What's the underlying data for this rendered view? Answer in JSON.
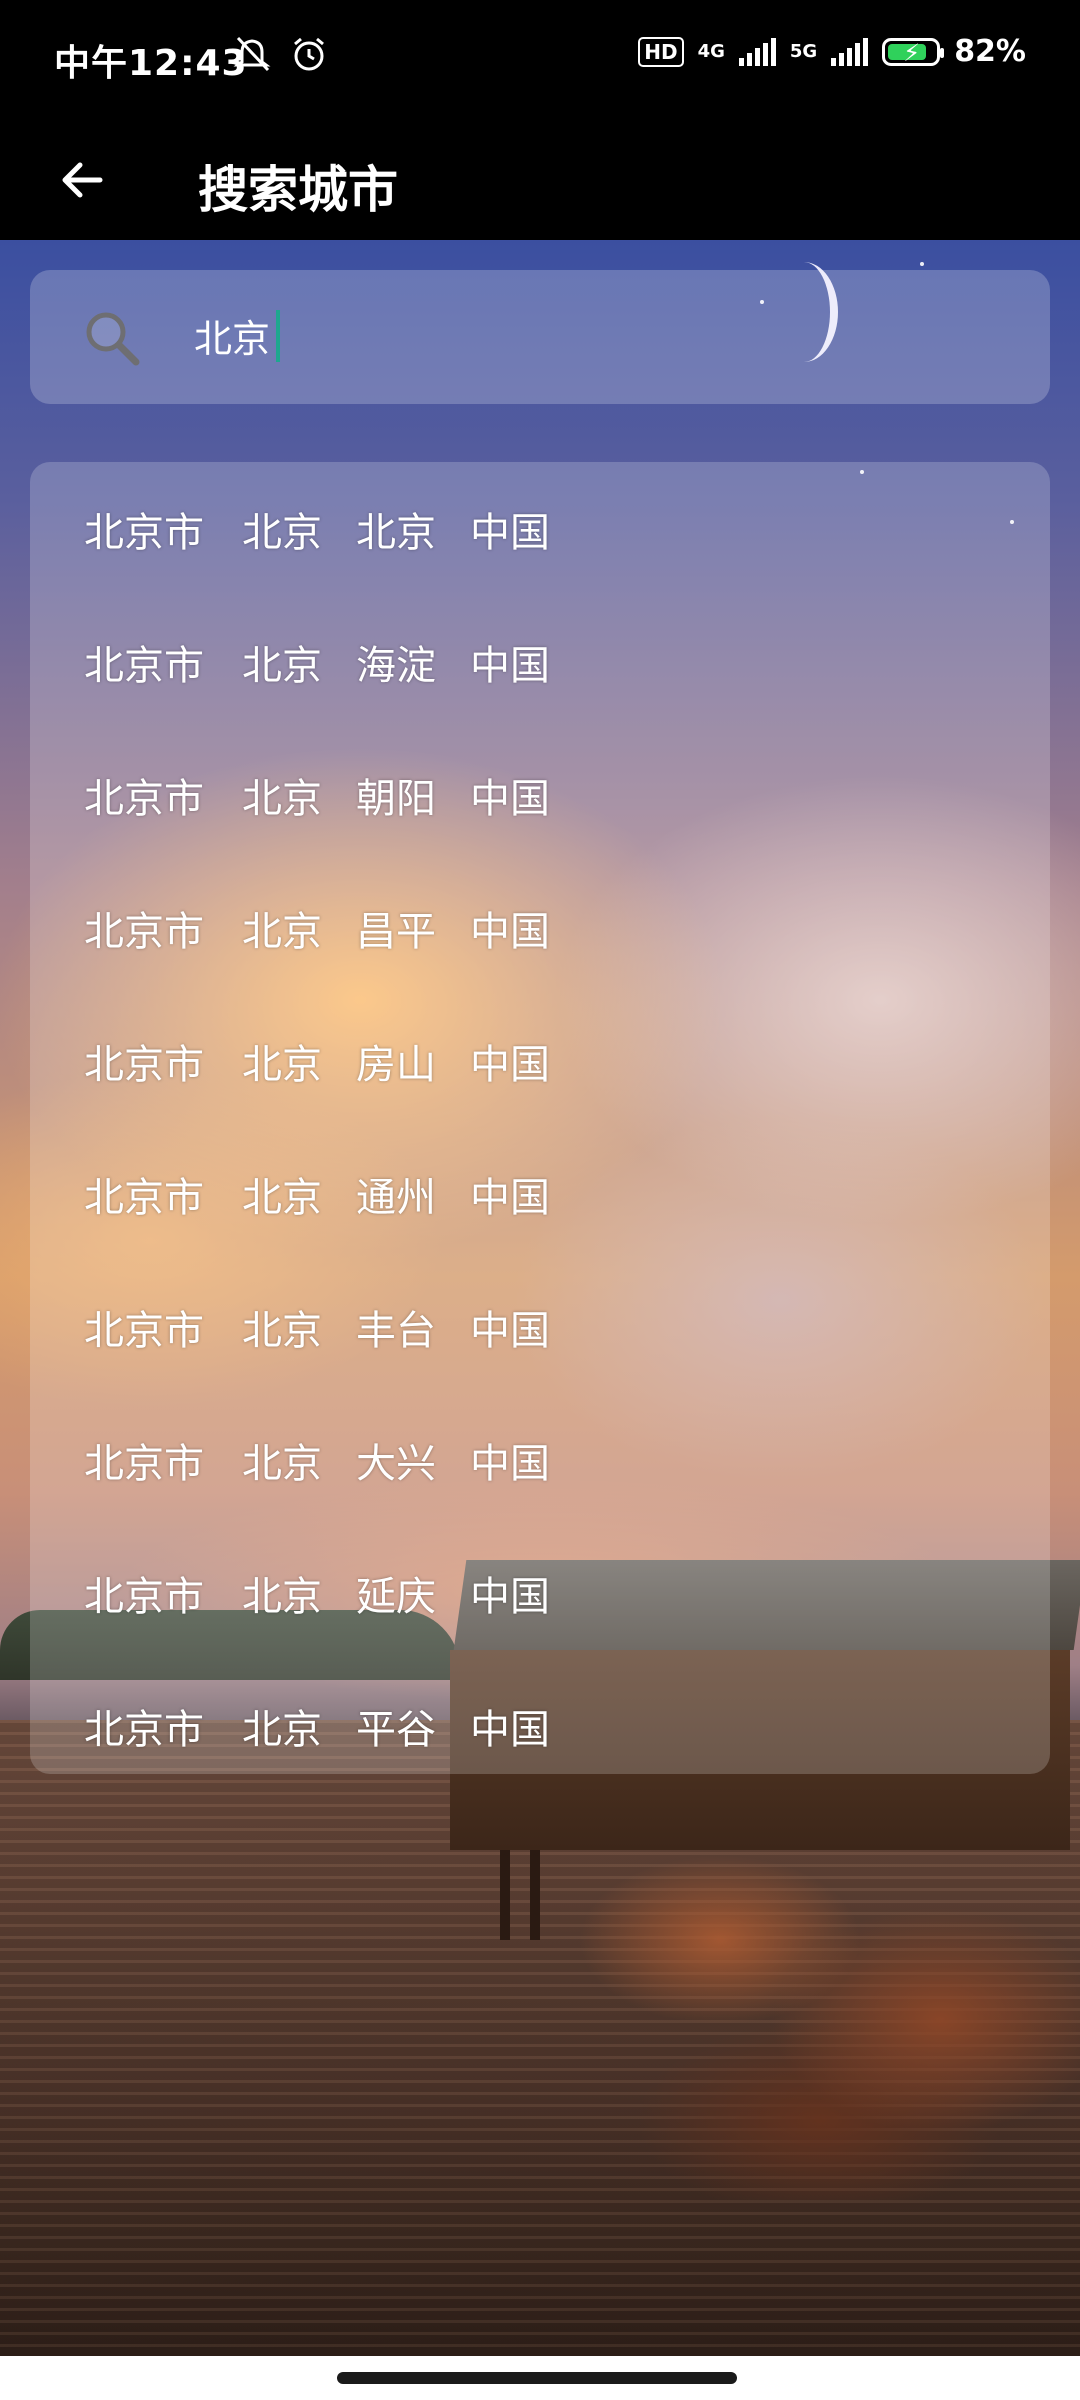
{
  "status_bar": {
    "time": "中午12:43",
    "left_icons": [
      "muted-icon",
      "alarm-icon"
    ],
    "hd": "HD",
    "net1": "4G",
    "net2": "5G",
    "battery": "82%",
    "battery_level": 0.82,
    "battery_color": "#2fd15b"
  },
  "app_bar": {
    "title": "搜索城市",
    "back_icon": "arrow-left-icon"
  },
  "search": {
    "value": "北京",
    "icon": "search-icon",
    "caret_color": "#1ea78f"
  },
  "results": [
    {
      "city": "北京市",
      "province": "北京",
      "district": "北京",
      "country": "中国"
    },
    {
      "city": "北京市",
      "province": "北京",
      "district": "海淀",
      "country": "中国"
    },
    {
      "city": "北京市",
      "province": "北京",
      "district": "朝阳",
      "country": "中国"
    },
    {
      "city": "北京市",
      "province": "北京",
      "district": "昌平",
      "country": "中国"
    },
    {
      "city": "北京市",
      "province": "北京",
      "district": "房山",
      "country": "中国"
    },
    {
      "city": "北京市",
      "province": "北京",
      "district": "通州",
      "country": "中国"
    },
    {
      "city": "北京市",
      "province": "北京",
      "district": "丰台",
      "country": "中国"
    },
    {
      "city": "北京市",
      "province": "北京",
      "district": "大兴",
      "country": "中国"
    },
    {
      "city": "北京市",
      "province": "北京",
      "district": "延庆",
      "country": "中国"
    },
    {
      "city": "北京市",
      "province": "北京",
      "district": "平谷",
      "country": "中国"
    }
  ]
}
